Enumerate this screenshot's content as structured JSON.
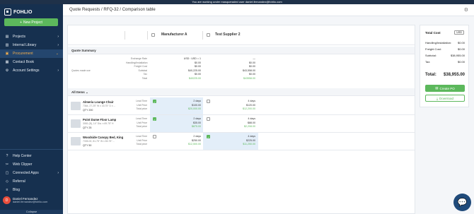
{
  "banner": "You are working under masqueraded user daniel.fernandez@fohlio.com",
  "app": {
    "logo_text": "FOHLIO",
    "new_project": "New Project"
  },
  "sidebar": {
    "items": [
      {
        "label": "Projects",
        "icon": "folder-icon"
      },
      {
        "label": "Internal Library",
        "icon": "book-icon"
      },
      {
        "label": "Procurement",
        "icon": "cart-icon",
        "active": true
      },
      {
        "label": "Contact Book",
        "icon": "contacts-icon"
      },
      {
        "label": "Account Settings",
        "icon": "gear-icon"
      }
    ],
    "bottom": [
      {
        "label": "Help Center",
        "icon": "help-icon"
      },
      {
        "label": "Web Clipper",
        "icon": "clip-icon"
      },
      {
        "label": "Connected Apps",
        "icon": "apps-icon"
      },
      {
        "label": "Referral",
        "icon": "gift-icon"
      },
      {
        "label": "Blog",
        "icon": "blog-icon"
      }
    ],
    "user": {
      "initial": "D",
      "name": "Daniel Fernandez",
      "email": "daniel.fernandez@fohlio.com"
    },
    "collapse": "Collapse"
  },
  "breadcrumb": "Quote Requests / RFQ-32 / Comparison table",
  "table": {
    "suppliers": [
      "Manufacturer A",
      "Test Supplier 2"
    ],
    "quote_summary_title": "Quote Summary",
    "quotes_made_label": "Quotes made use",
    "summary_labels": [
      "Exchange Rate",
      "Handling/Installation",
      "Freight Cost",
      "Subtotal",
      "Tax",
      "Total"
    ],
    "supplier_a_summary": [
      "USD : USD = 1",
      "$0.00",
      "$0.00",
      "$40,225.00",
      "$0.00",
      "$40225.00"
    ],
    "supplier_b_summary": [
      "—",
      "$0.00",
      "$0.00",
      "$43,558.00",
      "$0.00",
      "$43558.00"
    ],
    "all_items": "All Items",
    "row_labels": [
      "Lead Time",
      "Unit Price",
      "Total price"
    ],
    "items": [
      {
        "name": "Almeria Lounge Chair",
        "desc": "7364, 27.25\" W x 33.75\" D x ...",
        "qty": "QTY 200",
        "a": [
          "2 days",
          "$100.00",
          "$20,000.00"
        ],
        "b": [
          "4 days",
          "$120.00",
          "$12,200.00"
        ],
        "selected": "a"
      },
      {
        "name": "Point Dume Floor Lamp",
        "desc": "3081 (B), 14\" Dia. x 69.75\" H",
        "qty": "QTY 25",
        "a": [
          "2 days",
          "$35.00",
          "$875.00"
        ],
        "b": [
          "4 days",
          "$88.00",
          "$2,208.00"
        ],
        "selected": "a"
      },
      {
        "name": "Woodside Canopy Bed, King",
        "desc": "7335-00, 81.75\" W x 83.75\" ...",
        "qty": "QTY 50",
        "a": [
          "2 days",
          "$250.00",
          "$12,500.00"
        ],
        "b": [
          "4 days",
          "$225.00",
          "$11,250.00"
        ],
        "selected": "b"
      }
    ]
  },
  "summary": {
    "title": "Total Cost",
    "currency": "USD",
    "rows": [
      {
        "label": "Handling/Installation:",
        "value": "$0.00"
      },
      {
        "label": "Freight Cost:",
        "value": "$0.00"
      },
      {
        "label": "Subtotal:",
        "value": "$38,955.00"
      },
      {
        "label": "Tax:",
        "value": "$0.00"
      }
    ],
    "total_label": "Total:",
    "total_value": "$38,955.00",
    "create_po": "Create PO",
    "download": "Download"
  },
  "colors": {
    "sidebar": "#16304f",
    "accent": "#5cb85c",
    "active": "#f0ad4e",
    "selected_cell": "#e3eef9"
  }
}
